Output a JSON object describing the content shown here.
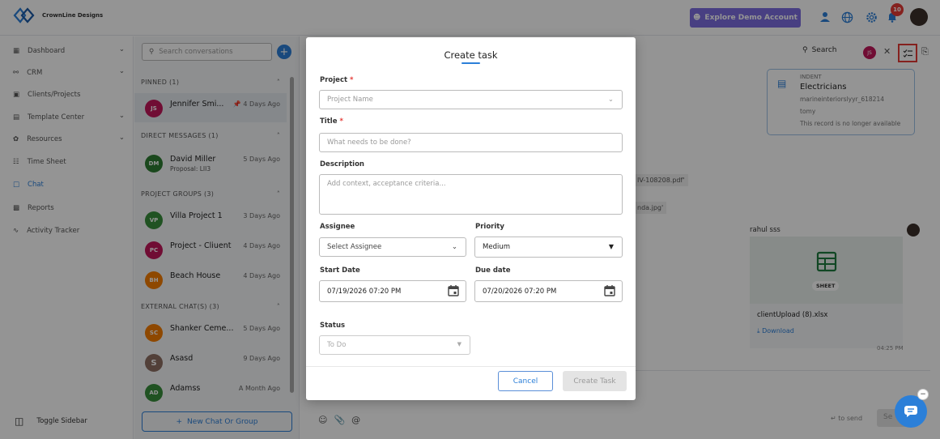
{
  "colors": {
    "accent": "#2b7fd8",
    "demo": "#7c6de0",
    "badge": "#e53935",
    "required": "#e53935"
  },
  "header": {
    "brand": "CrownLine Designs",
    "demo_button": "Explore Demo Account",
    "notification_count": "10",
    "icons": [
      "users-icon",
      "globe-icon",
      "gear-icon",
      "bell-icon"
    ]
  },
  "sidebar": {
    "items": [
      {
        "label": "Dashboard",
        "icon": "grid-icon"
      },
      {
        "label": "CRM",
        "icon": "users-icon"
      },
      {
        "label": "Clients/Projects",
        "icon": "building-icon"
      },
      {
        "label": "Template Center",
        "icon": "template-icon"
      },
      {
        "label": "Resources",
        "icon": "resources-icon"
      },
      {
        "label": "Time Sheet",
        "icon": "calendar-icon"
      },
      {
        "label": "Chat",
        "icon": "chat-icon"
      },
      {
        "label": "Reports",
        "icon": "chart-icon"
      },
      {
        "label": "Activity Tracker",
        "icon": "pulse-icon"
      }
    ],
    "toggle": "Toggle Sidebar"
  },
  "conversations": {
    "search_placeholder": "Search conversations",
    "new_chat": "New Chat Or Group",
    "sections": {
      "pinned": "PINNED (1)",
      "direct": "DIRECT MESSAGES (1)",
      "groups": "PROJECT GROUPS (3)",
      "external": "EXTERNAL CHAT(S) (3)"
    },
    "items": [
      {
        "initials": "JS",
        "name": "Jennifer Smi...",
        "time": "4 Days Ago",
        "color": "#c2185b"
      },
      {
        "initials": "DM",
        "name": "David Miller",
        "sub": "Proposal: LII3",
        "time": "5 Days Ago",
        "color": "#2e7d32"
      },
      {
        "initials": "VP",
        "name": "Villa Project 1",
        "time": "3 Days Ago",
        "color": "#388e3c"
      },
      {
        "initials": "PC",
        "name": "Project - Cliuent",
        "time": "4 Days Ago",
        "color": "#c2185b"
      },
      {
        "initials": "BH",
        "name": "Beach House",
        "time": "4 Days Ago",
        "color": "#f57c00"
      },
      {
        "initials": "SC",
        "name": "Shanker Ceme...",
        "time": "5 Days Ago",
        "color": "#f57c00"
      },
      {
        "initials": "S",
        "name": "Asasd",
        "time": "9 Days Ago",
        "color": "#8d6e63"
      },
      {
        "initials": "AD",
        "name": "Adamss",
        "time": "A Month Ago",
        "color": "#388e3c"
      }
    ]
  },
  "chat": {
    "search_label": "Search",
    "header_avatar": "JS",
    "indent": {
      "label": "INDENT",
      "title": "Electricians",
      "line1": "marineinteriorslyyr_618214",
      "line2": "tomy",
      "line3": "This record is no longer available"
    },
    "file1": "IV-108208.pdf'",
    "file2": "nda.jpg'",
    "sender": "rahul sss",
    "sheet_label": "SHEET",
    "file_name": "clientUpload (8).xlsx",
    "download": "Download",
    "msg_time": "04:25 PM",
    "to_send": "to send",
    "send": "Se"
  },
  "modal": {
    "title": "Create task",
    "project_label": "Project",
    "project_placeholder": "Project Name",
    "title_label": "Title",
    "title_placeholder": "What needs to be done?",
    "description_label": "Description",
    "description_placeholder": "Add context, acceptance criteria...",
    "assignee_label": "Assignee",
    "assignee_placeholder": "Select Assignee",
    "priority_label": "Priority",
    "priority_value": "Medium",
    "start_label": "Start Date",
    "start_value": "07/19/2026 07:20 PM",
    "due_label": "Due date",
    "due_value": "07/20/2026 07:20 PM",
    "status_label": "Status",
    "status_value": "To Do",
    "required_mark": "*",
    "cancel": "Cancel",
    "create": "Create Task"
  }
}
